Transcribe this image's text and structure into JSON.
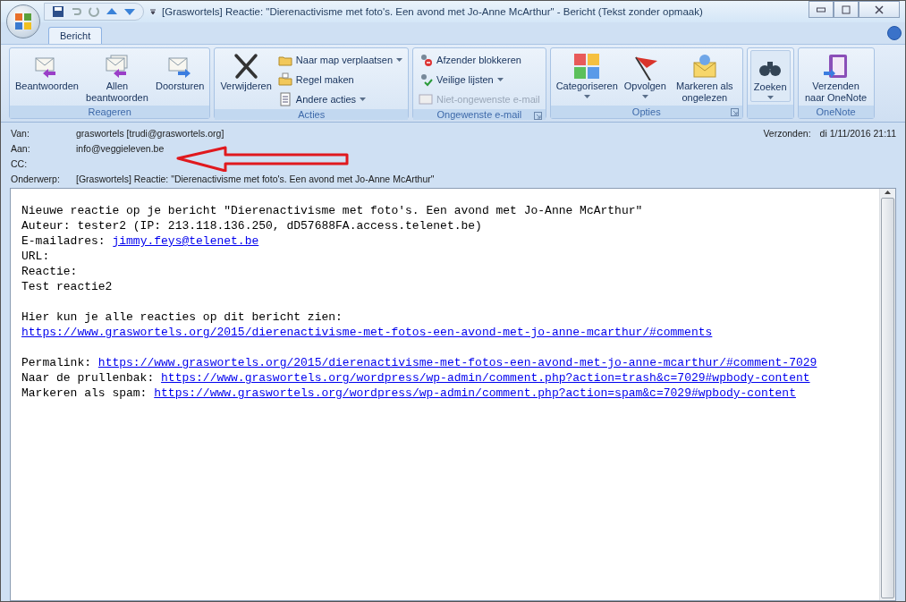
{
  "window": {
    "title": "[Graswortels] Reactie: \"Dierenactivisme met foto's. Een avond met Jo-Anne McArthur\"  -  Bericht (Tekst zonder opmaak)"
  },
  "tabs": [
    {
      "label": "Bericht",
      "selected": true
    }
  ],
  "ribbon": {
    "groups": [
      {
        "label": "Reageren",
        "buttons": [
          {
            "kind": "large",
            "label": "Beantwoorden"
          },
          {
            "kind": "large",
            "label": "Allen beantwoorden"
          },
          {
            "kind": "large",
            "label": "Doorsturen"
          }
        ]
      },
      {
        "label": "Acties",
        "buttons": [
          {
            "kind": "large",
            "label": "Verwijderen"
          },
          {
            "kind": "small",
            "label": "Naar map verplaatsen",
            "dropdown": true,
            "disabled": false
          },
          {
            "kind": "small",
            "label": "Regel maken",
            "disabled": false
          },
          {
            "kind": "small",
            "label": "Andere acties",
            "dropdown": true,
            "disabled": false
          }
        ]
      },
      {
        "label": "Ongewenste e-mail",
        "launcher": true,
        "buttons": [
          {
            "kind": "small",
            "label": "Afzender blokkeren",
            "disabled": false
          },
          {
            "kind": "small",
            "label": "Veilige lijsten",
            "dropdown": true,
            "disabled": false
          },
          {
            "kind": "small",
            "label": "Niet-ongewenste e-mail",
            "disabled": true
          }
        ]
      },
      {
        "label": "Opties",
        "launcher": true,
        "buttons": [
          {
            "kind": "large",
            "label": "Categoriseren",
            "dropdown": true
          },
          {
            "kind": "large",
            "label": "Opvolgen",
            "dropdown": true
          },
          {
            "kind": "large",
            "label": "Markeren als ongelezen"
          }
        ]
      },
      {
        "buttons": [
          {
            "kind": "large",
            "label": "Zoeken",
            "dropdown": true
          }
        ]
      },
      {
        "label": "OneNote",
        "buttons": [
          {
            "kind": "large",
            "label": "Verzenden naar OneNote"
          }
        ]
      }
    ]
  },
  "header": {
    "fields": [
      {
        "label": "Van:",
        "value": "graswortels [trudi@graswortels.org]"
      },
      {
        "label": "Aan:",
        "value": "info@veggieleven.be"
      },
      {
        "label": "CC:"
      },
      {
        "label": "Onderwerp:",
        "value": "[Graswortels] Reactie: \"Dierenactivisme met foto's. Een avond met Jo-Anne McArthur\""
      }
    ],
    "sent_label": "Verzonden:",
    "sent_value": "di 1/11/2016 21:11"
  },
  "body": {
    "lines": [
      {
        "kind": "text",
        "parts": [
          {
            "kind": "text",
            "text": "Nieuwe reactie op je bericht \"Dierenactivisme met foto's. Een avond met Jo-Anne McArthur\""
          }
        ]
      },
      {
        "kind": "text",
        "parts": [
          {
            "kind": "text",
            "text": "Auteur: tester2 (IP: 213.118.136.250, dD57688FA.access.telenet.be)"
          }
        ]
      },
      {
        "kind": "text",
        "parts": [
          {
            "kind": "text",
            "text": "E-mailadres: "
          },
          {
            "kind": "link",
            "text": "jimmy.feys@telenet.be"
          }
        ]
      },
      {
        "kind": "text",
        "parts": [
          {
            "kind": "text",
            "text": "URL:"
          }
        ]
      },
      {
        "kind": "text",
        "parts": [
          {
            "kind": "text",
            "text": "Reactie:"
          }
        ]
      },
      {
        "kind": "text",
        "parts": [
          {
            "kind": "text",
            "text": "Test reactie2"
          }
        ]
      },
      {
        "kind": "blank"
      },
      {
        "kind": "text",
        "parts": [
          {
            "kind": "text",
            "text": "Hier kun je alle reacties op dit bericht zien:"
          }
        ]
      },
      {
        "kind": "text",
        "parts": [
          {
            "kind": "link",
            "text": "https://www.graswortels.org/2015/dierenactivisme-met-fotos-een-avond-met-jo-anne-mcarthur/#comments"
          }
        ]
      },
      {
        "kind": "blank"
      },
      {
        "kind": "text",
        "parts": [
          {
            "kind": "text",
            "text": "Permalink: "
          },
          {
            "kind": "link",
            "text": "https://www.graswortels.org/2015/dierenactivisme-met-fotos-een-avond-met-jo-anne-mcarthur/#comment-7029"
          }
        ]
      },
      {
        "kind": "text",
        "parts": [
          {
            "kind": "text",
            "text": "Naar de prullenbak: "
          },
          {
            "kind": "link",
            "text": "https://www.graswortels.org/wordpress/wp-admin/comment.php?action=trash&c=7029#wpbody-content"
          }
        ]
      },
      {
        "kind": "text",
        "parts": [
          {
            "kind": "text",
            "text": "Markeren als spam: "
          },
          {
            "kind": "link",
            "text": "https://www.graswortels.org/wordpress/wp-admin/comment.php?action=spam&c=7029#wpbody-content"
          }
        ]
      }
    ]
  }
}
